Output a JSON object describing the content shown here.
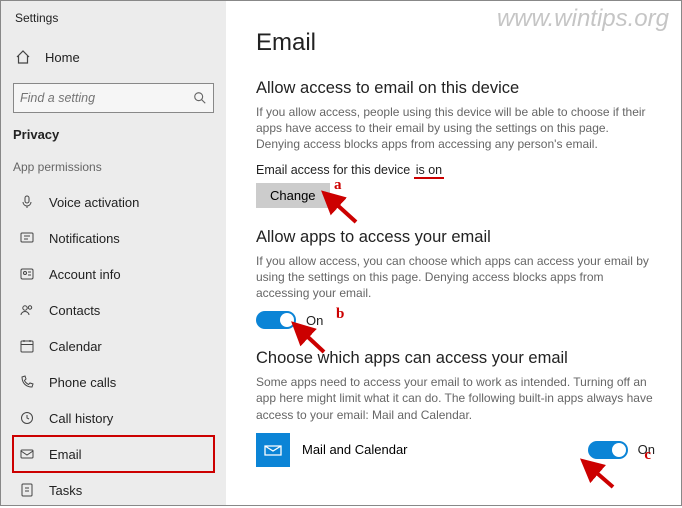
{
  "window_title": "Settings",
  "watermark": "www.wintips.org",
  "sidebar": {
    "home": "Home",
    "search_placeholder": "Find a setting",
    "section": "Privacy",
    "sub": "App permissions",
    "items": [
      {
        "label": "Voice activation"
      },
      {
        "label": "Notifications"
      },
      {
        "label": "Account info"
      },
      {
        "label": "Contacts"
      },
      {
        "label": "Calendar"
      },
      {
        "label": "Phone calls"
      },
      {
        "label": "Call history"
      },
      {
        "label": "Email",
        "selected": true
      },
      {
        "label": "Tasks"
      }
    ]
  },
  "main": {
    "title": "Email",
    "section1": {
      "heading": "Allow access to email on this device",
      "desc": "If you allow access, people using this device will be able to choose if their apps have access to their email by using the settings on this page. Denying access blocks apps from accessing any person's email.",
      "status_prefix": "Email access for this device ",
      "status_value": "is on",
      "button": "Change"
    },
    "section2": {
      "heading": "Allow apps to access your email",
      "desc": "If you allow access, you can choose which apps can access your email by using the settings on this page. Denying access blocks apps from accessing your email.",
      "toggle_label": "On"
    },
    "section3": {
      "heading": "Choose which apps can access your email",
      "desc": "Some apps need to access your email to work as intended. Turning off an app here might limit what it can do. The following built-in apps always have access to your email: Mail and Calendar.",
      "app_name": "Mail and Calendar",
      "app_toggle_label": "On"
    }
  },
  "annotations": {
    "a": "a",
    "b": "b",
    "c": "c"
  }
}
